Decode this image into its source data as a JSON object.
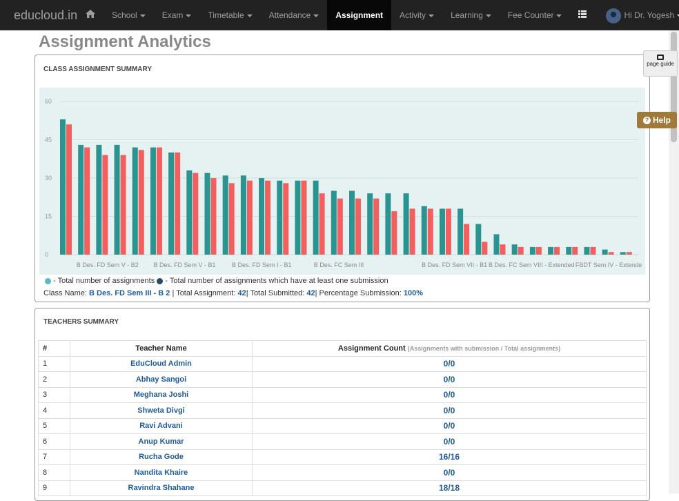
{
  "nav": {
    "brand": "educloud.in",
    "items": [
      {
        "label": "School",
        "caret": true
      },
      {
        "label": "Exam",
        "caret": true
      },
      {
        "label": "Timetable",
        "caret": true
      },
      {
        "label": "Attendance",
        "caret": true
      },
      {
        "label": "Assignment",
        "caret": false,
        "active": true
      },
      {
        "label": "Activity",
        "caret": true
      },
      {
        "label": "Learning",
        "caret": true
      },
      {
        "label": "Fee Counter",
        "caret": true
      }
    ],
    "user": "Hi Dr. Yogesh"
  },
  "page": {
    "title": "Assignment Analytics"
  },
  "sidebar": {
    "page_guide": "page guide",
    "help": "Help"
  },
  "summary": {
    "title": "CLASS ASSIGNMENT SUMMARY",
    "legend_total": "- Total number of assignments",
    "legend_submitted": "- Total number of assignments which have at least one submission",
    "class_label": "Class Name:",
    "class_name": "B Des. FD Sem III - B 2",
    "total_label": "Total Assignment:",
    "total_value": "42",
    "submitted_label": "Total Submitted:",
    "submitted_value": "42",
    "percent_label": "Percentage Submission:",
    "percent_value": "100%",
    "sep": "|"
  },
  "chart_data": {
    "type": "bar",
    "ylim": [
      0,
      60
    ],
    "yticks": [
      0,
      15,
      30,
      45,
      60
    ],
    "grid": true,
    "categories": [
      "",
      "B Des. FD Sem V - B2",
      "",
      "B Des. FD Sem V - B1",
      "",
      "B Des. FD Sem I - B1",
      "",
      "B Des. FC Sem III",
      "",
      "",
      "B Des. FD Sem VII - B1",
      "",
      "B Des. FC Sem VIII - Extended",
      "",
      "FBDT Sem IV - Extende"
    ],
    "series": [
      {
        "color": "#2a9590",
        "values": [
          53,
          43,
          43,
          43,
          42,
          42,
          40,
          33,
          32,
          31,
          31,
          30,
          29,
          29,
          29,
          25,
          25,
          24,
          24,
          24,
          19,
          18,
          18,
          12,
          8,
          4,
          3,
          3,
          3,
          3,
          2,
          1
        ]
      },
      {
        "color": "#f25f5f",
        "values": [
          51,
          42,
          39,
          39,
          41,
          42,
          40,
          32,
          30,
          28,
          29,
          29,
          28,
          29,
          24,
          22,
          22,
          22,
          17,
          18,
          18,
          18,
          12,
          5,
          4,
          3,
          3,
          3,
          3,
          3,
          1,
          1
        ]
      }
    ]
  },
  "teachers": {
    "title": "TEACHERS SUMMARY",
    "headers": {
      "num": "#",
      "name": "Teacher Name",
      "count": "Assignment Count",
      "count_sub": "(Assignments with submission / Total assignments)"
    },
    "rows": [
      {
        "num": "1",
        "name": "EduCloud Admin",
        "count": "0/0"
      },
      {
        "num": "2",
        "name": "Abhay Sangoi",
        "count": "0/0"
      },
      {
        "num": "3",
        "name": "Meghana Joshi",
        "count": "0/0"
      },
      {
        "num": "4",
        "name": "Shweta Divgi",
        "count": "0/0"
      },
      {
        "num": "5",
        "name": "Ravi Advani",
        "count": "0/0"
      },
      {
        "num": "6",
        "name": "Anup Kumar",
        "count": "0/0"
      },
      {
        "num": "7",
        "name": "Rucha Gode",
        "count": "16/16"
      },
      {
        "num": "8",
        "name": "Nandita Khaire",
        "count": "0/0"
      },
      {
        "num": "9",
        "name": "Ravindra Shahane",
        "count": "18/18"
      }
    ]
  }
}
